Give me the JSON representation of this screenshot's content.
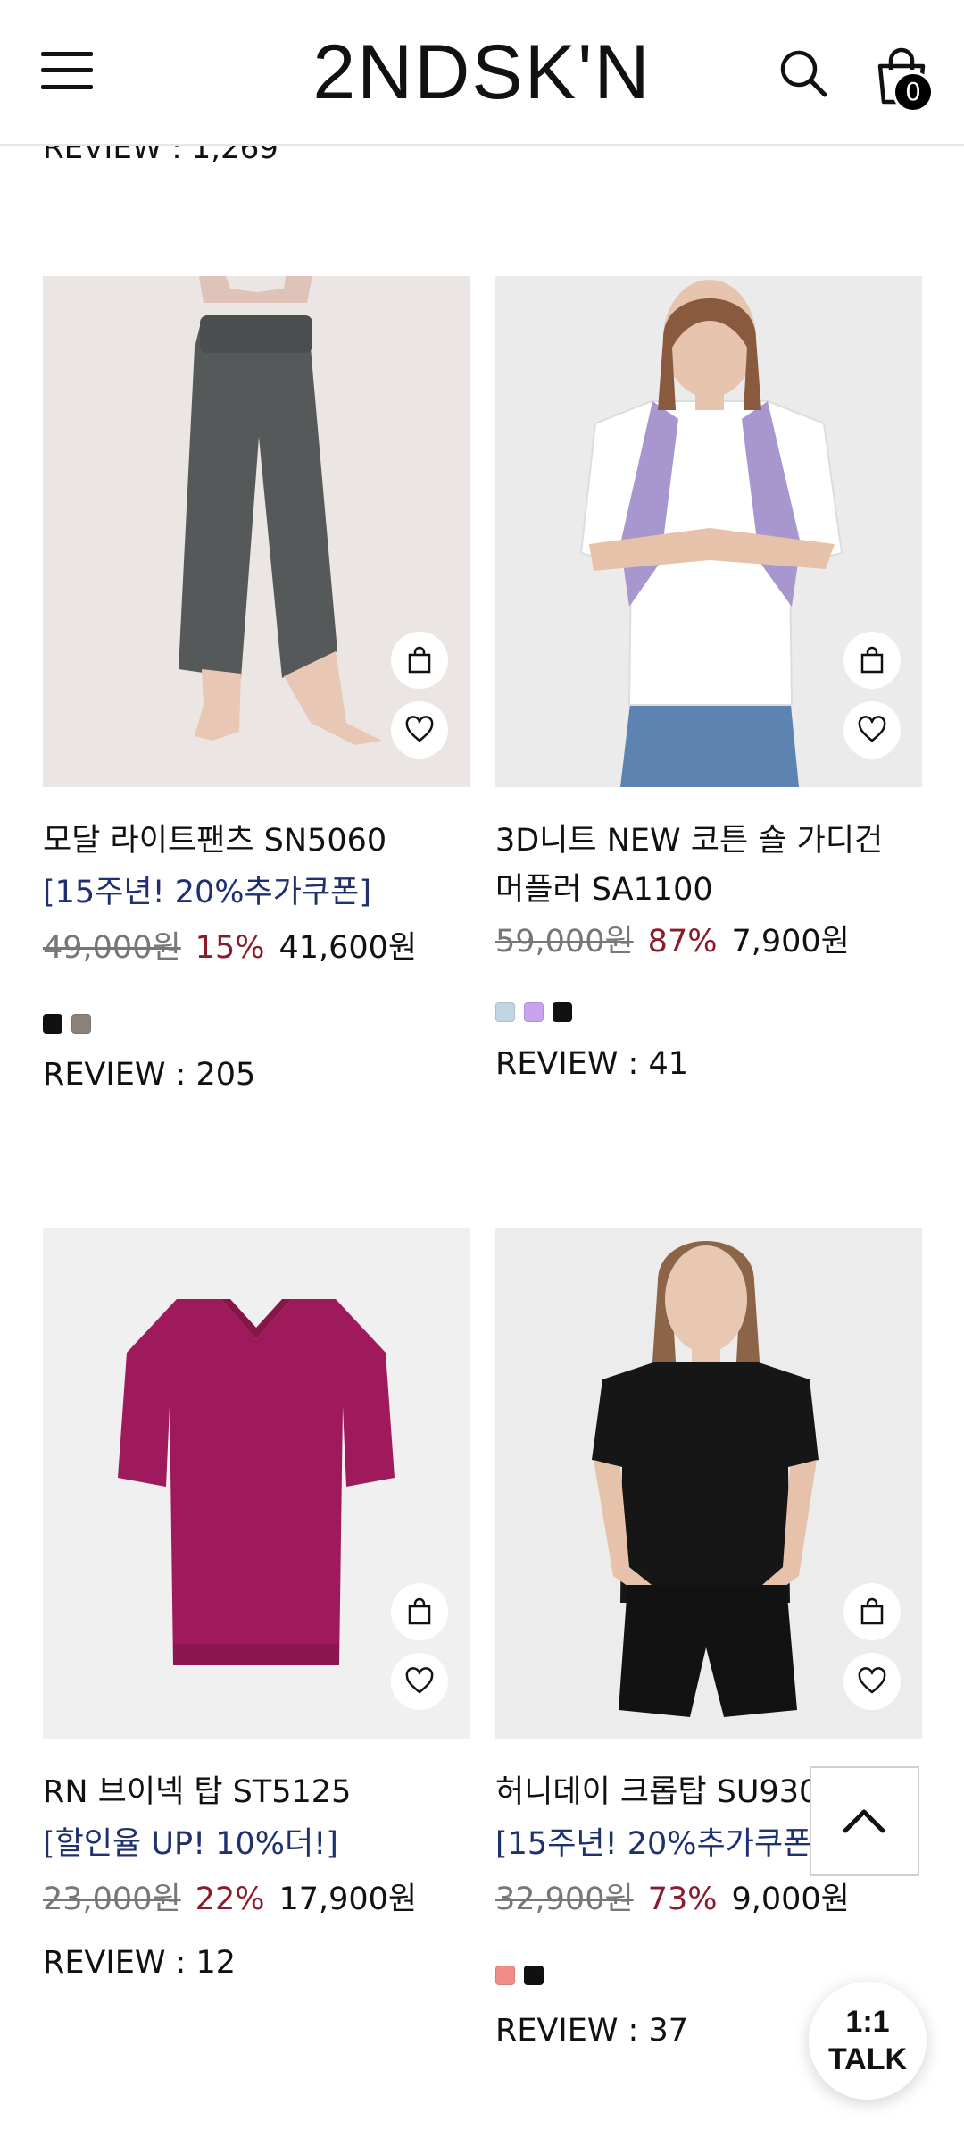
{
  "header": {
    "logo": "2NDSK'N",
    "cart_count": "0"
  },
  "top_review": "REVIEW : 1,269",
  "products": [
    {
      "name": "모달 라이트팬츠 SN5060",
      "promo": "[15주년! 20%추가쿠폰]",
      "original_price": "49,000원",
      "discount": "15%",
      "price": "41,600원",
      "swatches": [
        "#111111",
        "#8a827a"
      ],
      "review": "REVIEW : 205"
    },
    {
      "name_line1": "3D니트 NEW 코튼 숄 가디건",
      "name_line2": "머플러 SA1100",
      "original_price": "59,000원",
      "discount": "87%",
      "price": "7,900원",
      "swatches": [
        "#c3d4e2",
        "#c9a3ec",
        "#111111"
      ],
      "review": "REVIEW : 41"
    },
    {
      "name": "RN 브이넥 탑 ST5125",
      "promo": "[할인율 UP! 10%더!]",
      "original_price": "23,000원",
      "discount": "22%",
      "price": "17,900원",
      "review": "REVIEW : 12"
    },
    {
      "name": "허니데이 크롭탑 SU9300",
      "promo": "[15주년! 20%추가쿠폰]",
      "original_price": "32,900원",
      "discount": "73%",
      "price": "9,000원",
      "swatches": [
        "#f08c8a",
        "#111111"
      ],
      "review": "REVIEW : 37"
    }
  ],
  "floating": {
    "talk_line1": "1:1",
    "talk_line2": "TALK"
  },
  "icons": {
    "menu": "hamburger-icon",
    "search": "search-icon",
    "cart": "shopping-bag-icon",
    "add_to_cart": "shopping-bag-icon",
    "wishlist": "heart-icon",
    "scroll_top": "chevron-up-icon"
  }
}
